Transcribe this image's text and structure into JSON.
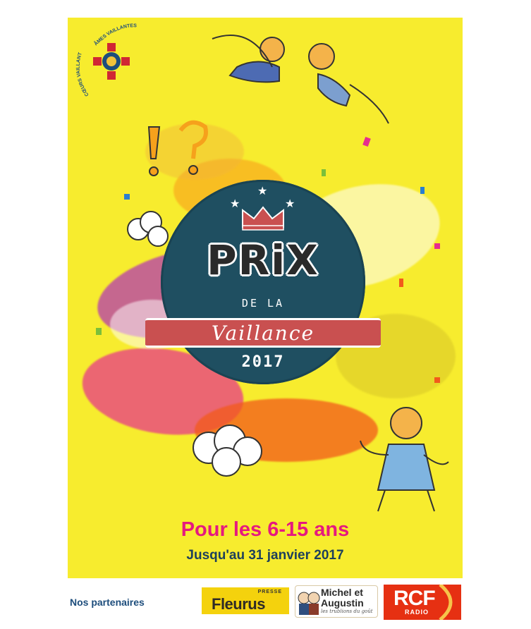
{
  "poster": {
    "crest": {
      "arc_top": "ÂMES VAILLANTES",
      "arc_left": "CŒURS VAILLANTS"
    },
    "badge": {
      "title": "PRiX",
      "de_la": "DE LA",
      "ribbon": "Vaillance",
      "year": "2017"
    },
    "headline": "Pour les 6-15 ans",
    "subline": "Jusqu'au 31 janvier 2017"
  },
  "footer": {
    "partners_label": "Nos partenaires",
    "partners": [
      {
        "name": "Fleurus",
        "small": "PRESSE"
      },
      {
        "name_line1": "Michel et",
        "name_line2": "Augustin",
        "tagline": "les trublions du goût"
      },
      {
        "name": "RCF",
        "small": "RADIO"
      }
    ]
  },
  "colors": {
    "poster_bg": "#f7ec2e",
    "badge": "#1f4f61",
    "ribbon": "#c95050",
    "headline": "#e5197f",
    "subline": "#1d3f5c",
    "partners_label": "#1d4d7c"
  }
}
